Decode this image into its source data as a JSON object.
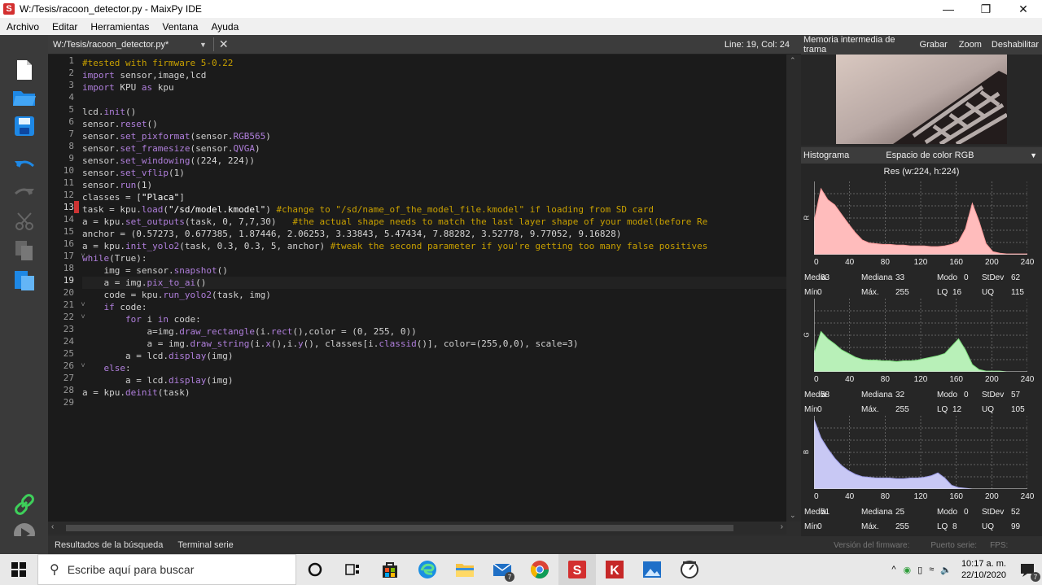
{
  "window": {
    "title": "W:/Tesis/racoon_detector.py - MaixPy IDE",
    "app_icon": "S"
  },
  "menu": [
    "Archivo",
    "Editar",
    "Herramientas",
    "Ventana",
    "Ayuda"
  ],
  "editor": {
    "file_tab": "W:/Tesis/racoon_detector.py*",
    "cursor_pos": "Line: 19, Col: 24",
    "current_line": 19,
    "marked_line": 13,
    "lines": [
      "#tested with firmware 5-0.22",
      "import sensor,image,lcd",
      "import KPU as kpu",
      "",
      "lcd.init()",
      "sensor.reset()",
      "sensor.set_pixformat(sensor.RGB565)",
      "sensor.set_framesize(sensor.QVGA)",
      "sensor.set_windowing((224, 224))",
      "sensor.set_vflip(1)",
      "sensor.run(1)",
      "classes = [\"Placa\"]",
      "task = kpu.load(\"/sd/model.kmodel\") #change to \"/sd/name_of_the_model_file.kmodel\" if loading from SD card",
      "a = kpu.set_outputs(task, 0, 7,7,30)   #the actual shape needs to match the last layer shape of your model(before Re",
      "anchor = (0.57273, 0.677385, 1.87446, 2.06253, 3.33843, 5.47434, 7.88282, 3.52778, 9.77052, 9.16828)",
      "a = kpu.init_yolo2(task, 0.3, 0.3, 5, anchor) #tweak the second parameter if you're getting too many false positives",
      "while(True):",
      "    img = sensor.snapshot()",
      "    a = img.pix_to_ai()",
      "    code = kpu.run_yolo2(task, img)",
      "    if code:",
      "        for i in code:",
      "            a=img.draw_rectangle(i.rect(),color = (0, 255, 0))",
      "            a = img.draw_string(i.x(),i.y(), classes[i.classid()], color=(255,0,0), scale=3)",
      "        a = lcd.display(img)",
      "    else:",
      "        a = lcd.display(img)",
      "a = kpu.deinit(task)",
      ""
    ],
    "fold_lines": [
      17,
      21,
      22,
      26
    ]
  },
  "bottom_tabs": [
    "Resultados de la búsqueda",
    "Terminal serie"
  ],
  "framebuffer": {
    "title": "Memoria intermedia de trama",
    "record": "Grabar",
    "zoom": "Zoom",
    "disable": "Deshabilitar"
  },
  "histogram": {
    "title": "Histograma",
    "color_space": "Espacio de color RGB",
    "resolution": "Res (w:224, h:224)",
    "axis_ticks": [
      "0",
      "40",
      "80",
      "120",
      "160",
      "200",
      "240"
    ],
    "channels": [
      {
        "label": "R",
        "color": "#ffbcbc",
        "stroke": "#ff9c9c",
        "values": [
          0.45,
          0.9,
          0.75,
          0.68,
          0.55,
          0.42,
          0.3,
          0.2,
          0.16,
          0.15,
          0.14,
          0.14,
          0.13,
          0.13,
          0.12,
          0.12,
          0.12,
          0.11,
          0.11,
          0.12,
          0.14,
          0.18,
          0.35,
          0.7,
          0.45,
          0.15,
          0.04,
          0.02,
          0.01,
          0.01,
          0.01,
          0.01
        ],
        "stats": {
          "media_label": "Media",
          "media": "63",
          "mediana_label": "Mediana",
          "mediana": "33",
          "modo_label": "Modo",
          "modo": "0",
          "stdev_label": "StDev",
          "stdev": "62",
          "min_label": "Mín.",
          "min": "0",
          "max_label": "Máx.",
          "max": "255",
          "lq_label": "LQ",
          "lq": "16",
          "uq_label": "UQ",
          "uq": "115"
        }
      },
      {
        "label": "G",
        "color": "#b8f0b8",
        "stroke": "#7fe07f",
        "values": [
          0.25,
          0.55,
          0.45,
          0.38,
          0.3,
          0.25,
          0.2,
          0.17,
          0.16,
          0.16,
          0.15,
          0.15,
          0.14,
          0.15,
          0.15,
          0.16,
          0.18,
          0.2,
          0.22,
          0.25,
          0.35,
          0.45,
          0.3,
          0.1,
          0.03,
          0.01,
          0.01,
          0.01,
          0.0,
          0.0,
          0.0,
          0.0
        ],
        "stats": {
          "media_label": "Media",
          "media": "58",
          "mediana_label": "Mediana",
          "mediana": "32",
          "modo_label": "Modo",
          "modo": "0",
          "stdev_label": "StDev",
          "stdev": "57",
          "min_label": "Mín.",
          "min": "0",
          "max_label": "Máx.",
          "max": "255",
          "lq_label": "LQ",
          "lq": "12",
          "uq_label": "UQ",
          "uq": "105"
        }
      },
      {
        "label": "B",
        "color": "#c8c8f4",
        "stroke": "#9d9de8",
        "values": [
          0.95,
          0.7,
          0.55,
          0.42,
          0.32,
          0.25,
          0.2,
          0.17,
          0.16,
          0.15,
          0.15,
          0.15,
          0.14,
          0.14,
          0.15,
          0.15,
          0.16,
          0.18,
          0.22,
          0.15,
          0.05,
          0.02,
          0.01,
          0.0,
          0.0,
          0.0,
          0.0,
          0.0,
          0.0,
          0.0,
          0.0,
          0.0
        ],
        "stats": {
          "media_label": "Media",
          "media": "51",
          "mediana_label": "Mediana",
          "mediana": "25",
          "modo_label": "Modo",
          "modo": "0",
          "stdev_label": "StDev",
          "stdev": "52",
          "min_label": "Mín.",
          "min": "0",
          "max_label": "Máx.",
          "max": "255",
          "lq_label": "LQ",
          "lq": "8",
          "uq_label": "UQ",
          "uq": "99"
        }
      }
    ]
  },
  "status_right": {
    "firmware": "Versión del firmware:",
    "port": "Puerto serie:",
    "fps": "FPS:"
  },
  "taskbar": {
    "search_placeholder": "Escribe aquí para buscar",
    "time": "10:17 a. m.",
    "date": "22/10/2020",
    "mail_badge": "7",
    "notif_badge": "7"
  }
}
